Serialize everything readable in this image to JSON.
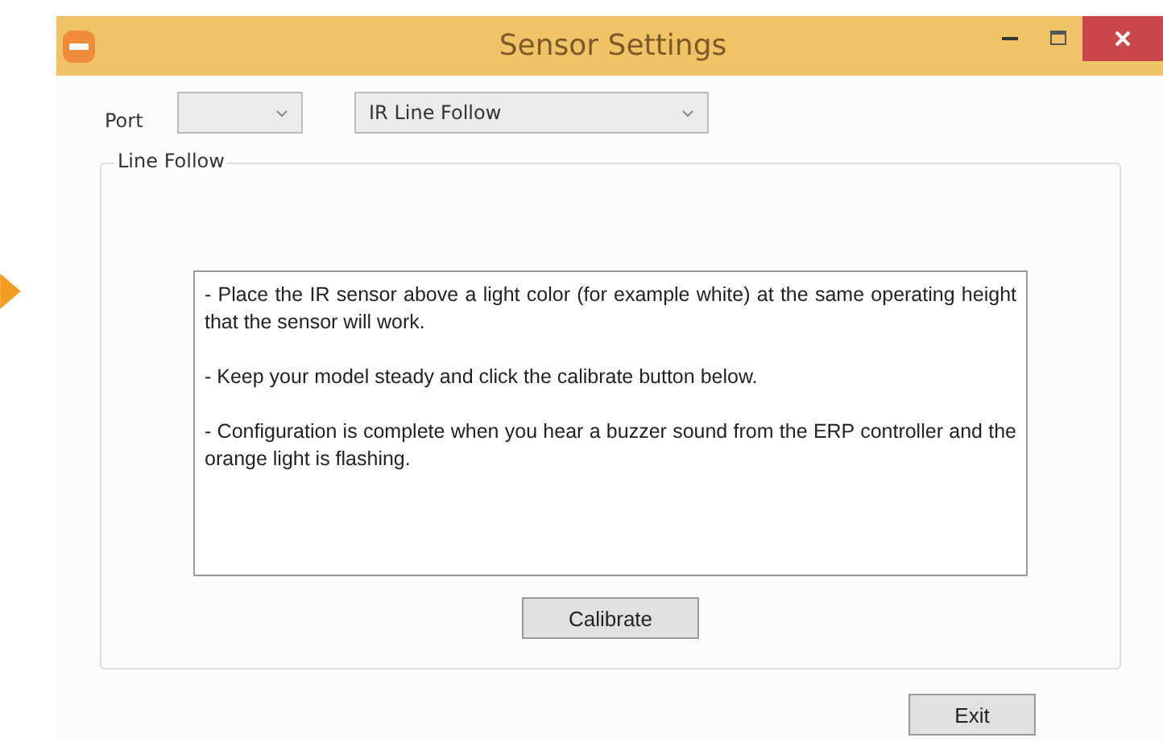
{
  "window": {
    "title": "Sensor Settings"
  },
  "port": {
    "label": "Port"
  },
  "mode": {
    "value": "IR Line Follow"
  },
  "group": {
    "title": "Line Follow",
    "instructions": [
      "- Place the IR sensor above a light color (for example white) at the same operating height that the sensor will work.",
      "- Keep your model steady and click the calibrate button below.",
      "- Configuration is complete when you hear a buzzer sound from the ERP controller and the orange light is flashing."
    ],
    "button": "Calibrate"
  },
  "buttons": [
    "Exit"
  ]
}
